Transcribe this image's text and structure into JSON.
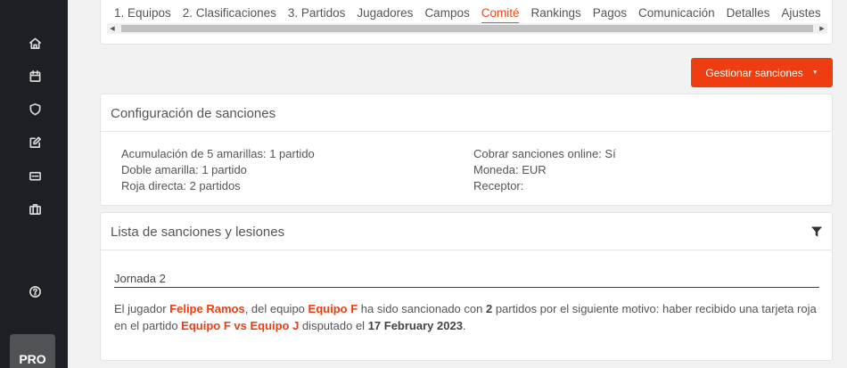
{
  "sidebar": {
    "icons": [
      "home-icon",
      "calendar-icon",
      "shield-icon",
      "edit-icon",
      "ticket-icon",
      "briefcase-icon",
      "help-icon"
    ],
    "pro_label": "PRO"
  },
  "tabs": [
    {
      "label": "1. Equipos"
    },
    {
      "label": "2. Clasificaciones"
    },
    {
      "label": "3. Partidos"
    },
    {
      "label": "Jugadores"
    },
    {
      "label": "Campos"
    },
    {
      "label": "Comité",
      "active": true
    },
    {
      "label": "Rankings"
    },
    {
      "label": "Pagos"
    },
    {
      "label": "Comunicación"
    },
    {
      "label": "Detalles"
    },
    {
      "label": "Ajustes"
    }
  ],
  "manage_button": {
    "label": "Gestionar sanciones"
  },
  "config": {
    "title": "Configuración de sanciones",
    "left": [
      "Acumulación de 5 amarillas: 1 partido",
      "Doble amarilla: 1 partido",
      "Roja directa: 2 partidos"
    ],
    "right": [
      "Cobrar sanciones online: Sí",
      "Moneda: EUR",
      "Receptor:"
    ]
  },
  "list": {
    "title": "Lista de sanciones y lesiones",
    "matchday": "Jornada 2",
    "sanction": {
      "t1": "El jugador ",
      "player": "Felipe Ramos",
      "t2": ", del equipo ",
      "team": "Equipo F",
      "t3": " ha sido sancionado con ",
      "games": "2",
      "t4": " partidos por el siguiente motivo: haber recibido una tarjeta roja en el partido ",
      "match": "Equipo F vs Equipo J",
      "t5": " disputado el ",
      "date": "17 February 2023",
      "t6": "."
    }
  },
  "colors": {
    "accent": "#ee3d10",
    "sidebar": "#1c1f24"
  }
}
